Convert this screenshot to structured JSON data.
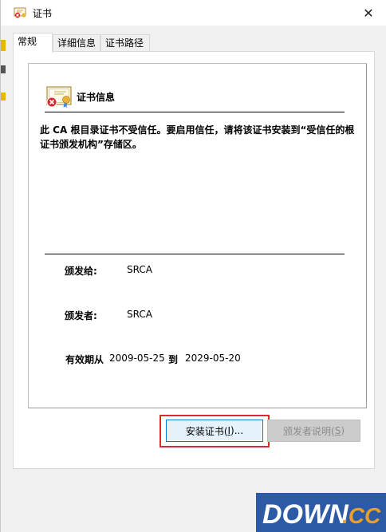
{
  "window": {
    "title": "证书",
    "close_glyph": "✕"
  },
  "tabs": [
    {
      "label": "常规",
      "active": true
    },
    {
      "label": "详细信息",
      "active": false
    },
    {
      "label": "证书路径",
      "active": false
    }
  ],
  "cert": {
    "section_title": "证书信息",
    "warning": "此 CA 根目录证书不受信任。要启用信任，请将该证书安装到“受信任的根证书颁发机构”存储区。",
    "issued_to_label": "颁发给:",
    "issued_to_value": "SRCA",
    "issued_by_label": "颁发者:",
    "issued_by_value": "SRCA",
    "valid_label": "有效期从",
    "valid_from": "2009-05-25",
    "valid_to_word": "到",
    "valid_to": "2029-05-20"
  },
  "buttons": {
    "install_label": "安装证书(",
    "install_key": "I",
    "install_suffix": ")...",
    "issuer_label": "颁发者说明(",
    "issuer_key": "S",
    "issuer_suffix": ")"
  },
  "watermark": {
    "text_main": "DOWN",
    "text_suffix": ".CC"
  },
  "colors": {
    "accent": "#0078d7",
    "highlight": "#e0262e",
    "watermark_bg": "#2d5aa6"
  },
  "icons": [
    "certificate-icon",
    "close-icon",
    "certificate-error-icon"
  ]
}
